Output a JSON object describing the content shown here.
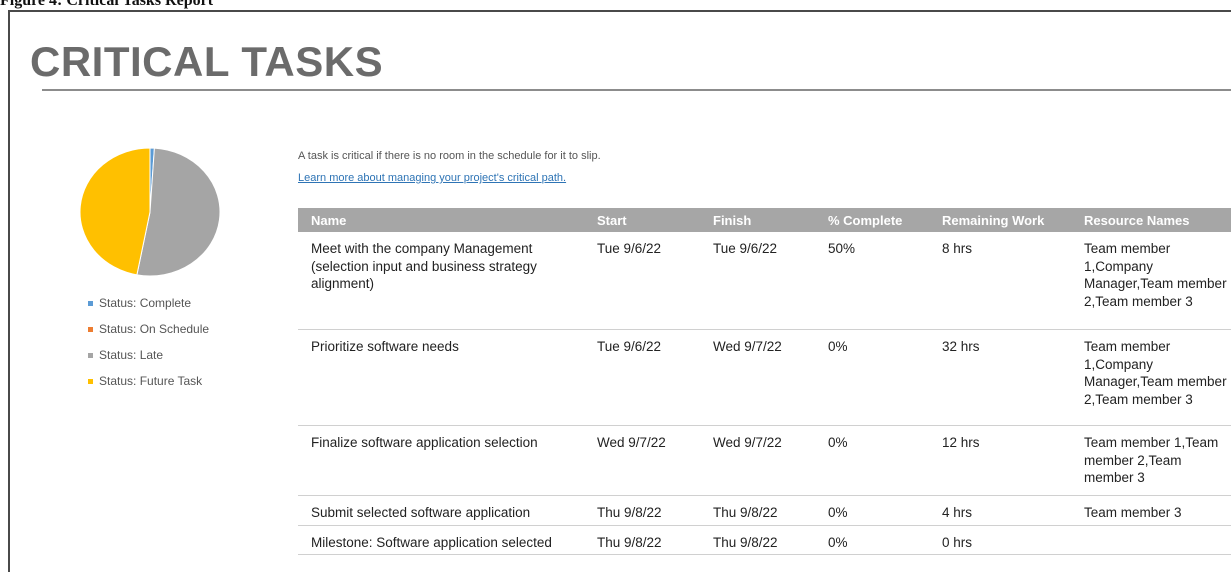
{
  "header_fragment": "Figure 4: Critical Tasks Report",
  "page": {
    "title": "CRITICAL TASKS"
  },
  "intro_text": "A task is critical if there is no room in the schedule for it to slip.",
  "learn_more_link": "Learn more about managing your project's critical path.",
  "status_chart": {
    "slices": [
      {
        "name": "Status: Complete",
        "value": 1,
        "color": "#5b9bd5"
      },
      {
        "name": "Status: On Schedule",
        "value": 0,
        "color": "#ed7d31"
      },
      {
        "name": "Status: Late",
        "value": 52,
        "color": "#a5a5a5"
      },
      {
        "name": "Status: Future Task",
        "value": 47,
        "color": "#ffc000"
      }
    ]
  },
  "table": {
    "columns": [
      "Name",
      "Start",
      "Finish",
      "% Complete",
      "Remaining Work",
      "Resource Names"
    ],
    "rows": [
      {
        "name": "Meet with the company Management (selection input and business strategy alignment)",
        "start": "Tue 9/6/22",
        "finish": "Tue 9/6/22",
        "pct": "50%",
        "remaining": "8 hrs",
        "resources": "Team member 1,Company Manager,Team member 2,Team member 3"
      },
      {
        "name": "Prioritize software needs",
        "start": "Tue 9/6/22",
        "finish": "Wed 9/7/22",
        "pct": "0%",
        "remaining": "32 hrs",
        "resources": "Team member 1,Company Manager,Team member 2,Team member 3"
      },
      {
        "name": "Finalize software application selection",
        "start": "Wed 9/7/22",
        "finish": "Wed 9/7/22",
        "pct": "0%",
        "remaining": "12 hrs",
        "resources": "Team member 1,Team member 2,Team member 3"
      },
      {
        "name": "Submit selected software application",
        "start": "Thu 9/8/22",
        "finish": "Thu 9/8/22",
        "pct": "0%",
        "remaining": "4 hrs",
        "resources": "Team member 3"
      },
      {
        "name": "Milestone: Software application selected",
        "start": "Thu 9/8/22",
        "finish": "Thu 9/8/22",
        "pct": "0%",
        "remaining": "0 hrs",
        "resources": ""
      }
    ]
  }
}
